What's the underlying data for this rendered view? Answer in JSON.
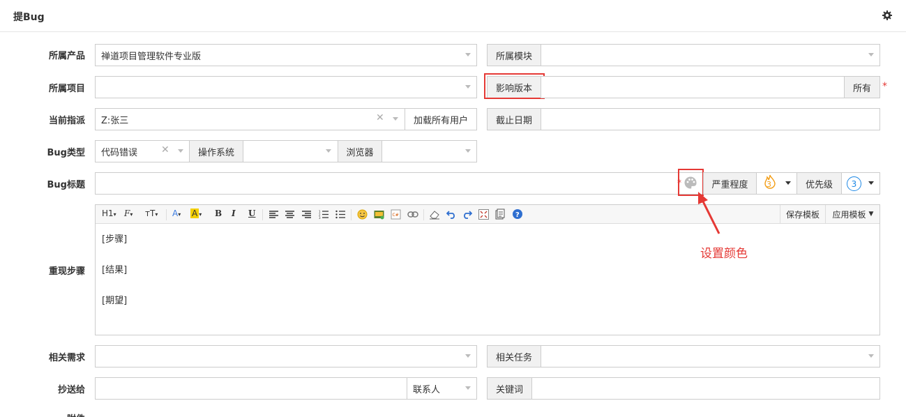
{
  "header": {
    "title": "提Bug",
    "settings_icon": "gear-icon"
  },
  "fields": {
    "product_label": "所属产品",
    "product_value": "禅道项目管理软件专业版",
    "module_label": "所属模块",
    "project_label": "所属项目",
    "affected_version_label": "影响版本",
    "affected_version_all": "所有",
    "assigned_label": "当前指派",
    "assigned_value": "Z:张三",
    "load_all_users": "加载所有用户",
    "deadline_label": "截止日期",
    "bugtype_label": "Bug类型",
    "bugtype_value": "代码错误",
    "os_label": "操作系统",
    "browser_label": "浏览器",
    "bugtitle_label": "Bug标题",
    "severity_label": "严重程度",
    "severity_value": "3",
    "priority_label": "优先级",
    "priority_value": "3",
    "steps_label": "重现步骤",
    "related_story_label": "相关需求",
    "related_task_label": "相关任务",
    "cc_label": "抄送给",
    "contacts_label": "联系人",
    "keywords_label": "关键词",
    "attachment_label": "附件"
  },
  "toolbar": {
    "h1": "H1",
    "font_family": "F",
    "font_size": "тT",
    "font_color": "A",
    "bg_color": "A",
    "bold": "B",
    "italic": "I",
    "underline": "U",
    "save_template": "保存模板",
    "apply_template": "应用模板"
  },
  "editor": {
    "line1": "[步骤]",
    "line2": "[结果]",
    "line3": "[期望]"
  },
  "annotation": {
    "text": "设置颜色"
  },
  "colors": {
    "accent_red": "#e53935",
    "flame": "#f39c12",
    "priority_blue": "#1e88e5"
  }
}
